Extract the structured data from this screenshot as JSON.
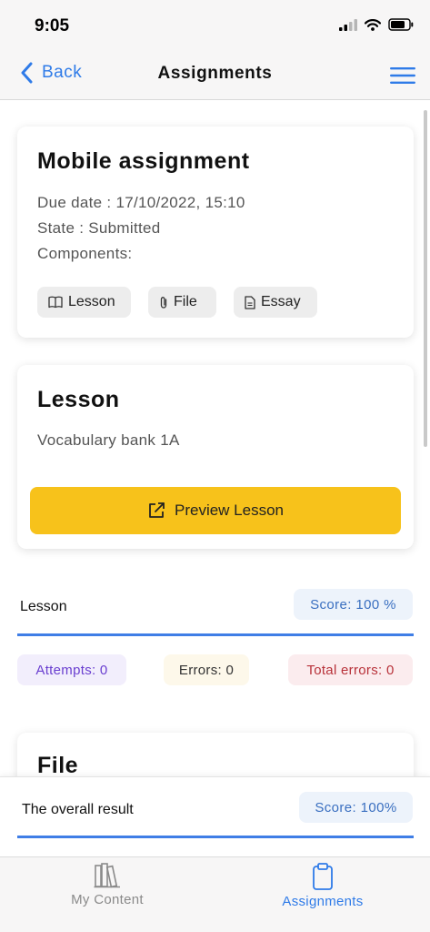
{
  "status_bar": {
    "time": "9:05"
  },
  "nav": {
    "back_label": "Back",
    "title": "Assignments"
  },
  "assignment": {
    "title": "Mobile assignment",
    "due_date": "Due date : 17/10/2022, 15:10",
    "state": "State : Submitted",
    "components_label": "Components:",
    "chips": [
      "Lesson",
      "File",
      "Essay"
    ]
  },
  "lesson_card": {
    "title": "Lesson",
    "subtitle": "Vocabulary bank 1A",
    "button_label": "Preview Lesson"
  },
  "lesson_result": {
    "label": "Lesson",
    "score": "Score: 100 %",
    "attempts": "Attempts: 0",
    "errors": "Errors: 0",
    "total_errors": "Total errors: 0"
  },
  "file_card": {
    "title": "File"
  },
  "overall": {
    "label": "The overall result",
    "score": "Score: 100%"
  },
  "tabs": [
    {
      "label": "My Content",
      "active": false
    },
    {
      "label": "Assignments",
      "active": true
    }
  ],
  "colors": {
    "accent": "#2f7be8",
    "button_yellow": "#f7c21b",
    "attempts_text": "#6a3fd0",
    "errors_text": "#333333",
    "total_errors_text": "#b8323a"
  }
}
